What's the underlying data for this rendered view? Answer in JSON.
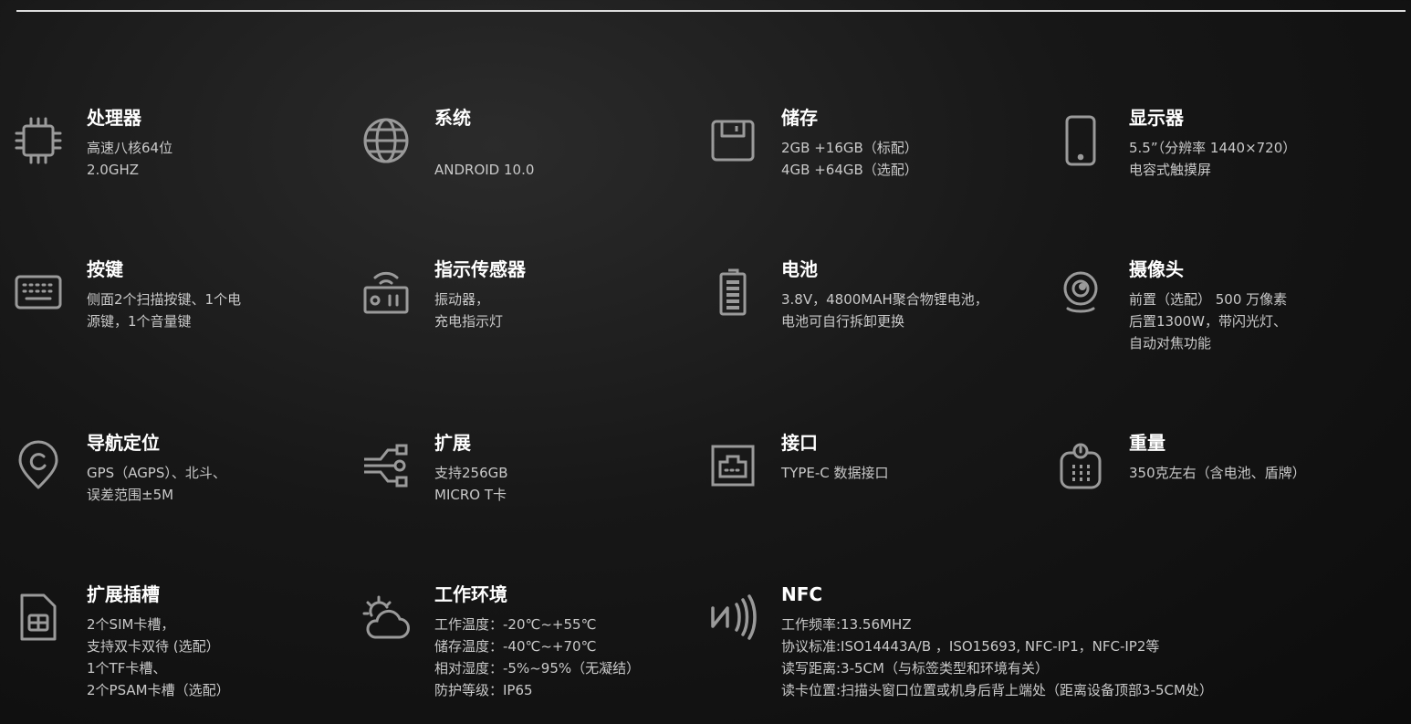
{
  "specs": [
    {
      "title": "处理器",
      "icon": "cpu-icon",
      "lines": [
        "高速八核64位",
        "2.0GHZ"
      ]
    },
    {
      "title": "系统",
      "icon": "globe-icon",
      "lines": [
        "",
        "ANDROID 10.0"
      ]
    },
    {
      "title": "储存",
      "icon": "floppy-disk-icon",
      "lines": [
        "2GB +16GB（标配）",
        "4GB +64GB（选配）"
      ]
    },
    {
      "title": "显示器",
      "icon": "smartphone-icon",
      "lines": [
        "5.5”（分辨率 1440×720）",
        "电容式触摸屏"
      ]
    },
    {
      "title": "按键",
      "icon": "keyboard-icon",
      "lines": [
        "侧面2个扫描按键、1个电",
        "源键，1个音量键"
      ]
    },
    {
      "title": "指示传感器",
      "icon": "sensor-icon",
      "lines": [
        "振动器，",
        "充电指示灯"
      ]
    },
    {
      "title": "电池",
      "icon": "battery-icon",
      "lines": [
        "3.8V，4800MAH聚合物锂电池，",
        "电池可自行拆卸更换"
      ]
    },
    {
      "title": "摄像头",
      "icon": "webcam-icon",
      "lines": [
        "前置（选配） 500 万像素",
        "后置1300W，带闪光灯、",
        "自动对焦功能"
      ]
    },
    {
      "title": "导航定位",
      "icon": "location-pin-icon",
      "lines": [
        "GPS（AGPS）、北斗、",
        "误差范围±5M"
      ]
    },
    {
      "title": "扩展",
      "icon": "network-expand-icon",
      "lines": [
        "支持256GB",
        "MICRO T卡"
      ]
    },
    {
      "title": "接口",
      "icon": "ethernet-port-icon",
      "lines": [
        "TYPE-C 数据接口"
      ]
    },
    {
      "title": "重量",
      "icon": "scale-icon",
      "lines": [
        "350克左右（含电池、盾牌）"
      ]
    },
    {
      "title": "扩展插槽",
      "icon": "sim-card-icon",
      "lines": [
        "2个SIM卡槽，",
        "支持双卡双待 (选配）",
        "1个TF卡槽、",
        "2个PSAM卡槽（选配）"
      ]
    },
    {
      "title": "工作环境",
      "icon": "weather-cloud-sun-icon",
      "lines": [
        "工作温度：-20℃~+55℃",
        "储存温度：-40℃~+70℃",
        "相对湿度：-5%~95%（无凝结）",
        "防护等级：IP65"
      ]
    },
    {
      "title": "NFC",
      "icon": "nfc-icon",
      "lines": [
        "工作频率:13.56MHZ",
        "协议标准:ISO14443A/B ，ISO15693, NFC-IP1，NFC-IP2等",
        "读写距离:3-5CM（与标签类型和环境有关）",
        "读卡位置:扫描头窗口位置或机身后背上端处（距离设备顶部3-5CM处）"
      ]
    }
  ]
}
